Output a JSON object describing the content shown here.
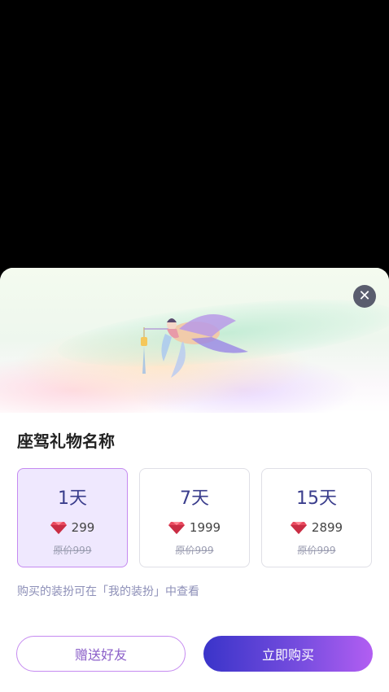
{
  "sheet": {
    "title": "座驾礼物名称",
    "note": "购买的装扮可在「我的装扮」中查看",
    "close_icon": "close-icon"
  },
  "plans": [
    {
      "duration": "1天",
      "price": "299",
      "original": "原价999",
      "selected": true
    },
    {
      "duration": "7天",
      "price": "1999",
      "original": "原价999",
      "selected": false
    },
    {
      "duration": "15天",
      "price": "2899",
      "original": "原价999",
      "selected": false
    }
  ],
  "buttons": {
    "gift_label": "赠送好友",
    "buy_label": "立即购买"
  },
  "colors": {
    "accent": "#3a34c9",
    "accent_end": "#b25ef2",
    "selected_bg": "#efe8fe",
    "selected_border": "#c58af0"
  }
}
